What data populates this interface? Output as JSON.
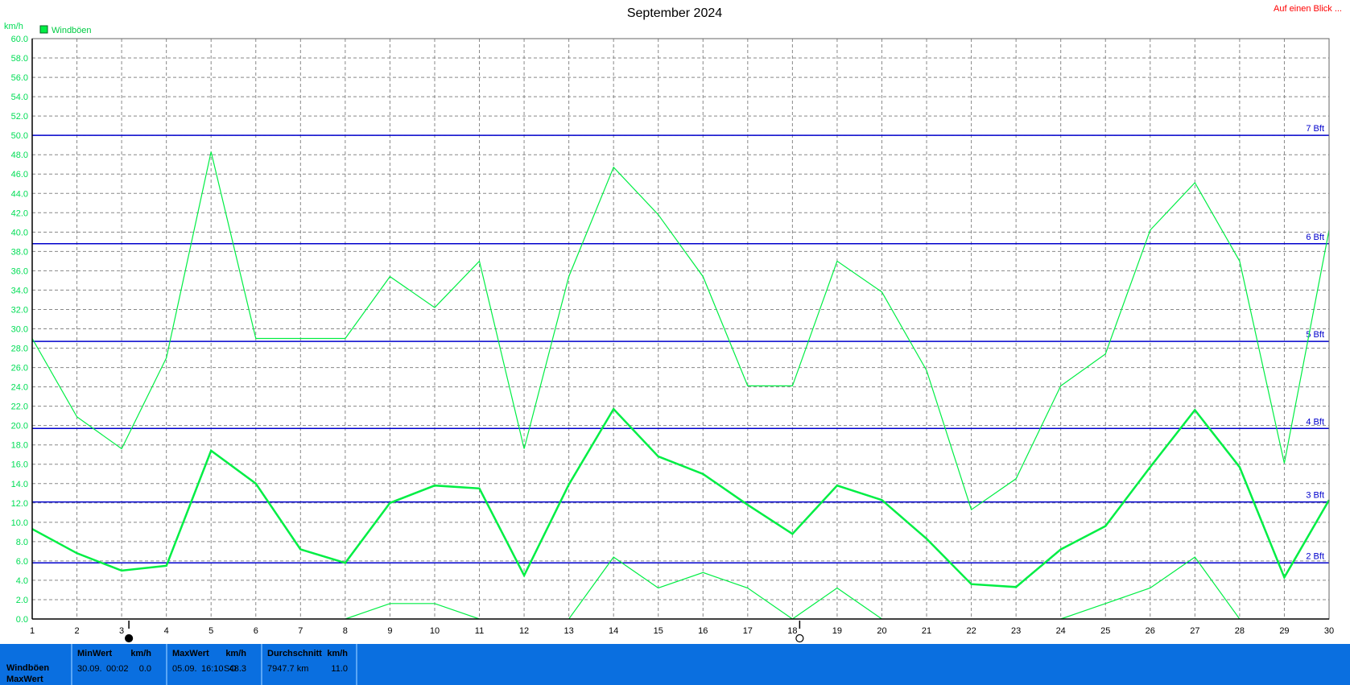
{
  "page": {
    "title": "September 2024",
    "top_link": "Auf einen Blick ...",
    "unit_label": "km/h",
    "colors": {
      "series": "#00ee44",
      "bft_line": "#0000cc",
      "stats_bg": "#0a6fe0",
      "link": "#ff0000"
    }
  },
  "chart_data": {
    "type": "line",
    "title": "September 2024",
    "ylabel": "km/h",
    "xlabel": "",
    "x": [
      1,
      2,
      3,
      4,
      5,
      6,
      7,
      8,
      9,
      10,
      11,
      12,
      13,
      14,
      15,
      16,
      17,
      18,
      19,
      20,
      21,
      22,
      23,
      24,
      25,
      26,
      27,
      28,
      29,
      30
    ],
    "ylim": [
      0,
      60
    ],
    "yticks": [
      "0.0",
      "2.0",
      "4.0",
      "6.0",
      "8.0",
      "10.0",
      "12.0",
      "14.0",
      "16.0",
      "18.0",
      "20.0",
      "22.0",
      "24.0",
      "26.0",
      "28.0",
      "30.0",
      "32.0",
      "34.0",
      "36.0",
      "38.0",
      "40.0",
      "42.0",
      "44.0",
      "46.0",
      "48.0",
      "50.0",
      "52.0",
      "54.0",
      "56.0",
      "58.0",
      "60.0"
    ],
    "grid": true,
    "legend": {
      "position": "top-left",
      "entries": [
        "Windböen"
      ]
    },
    "series": [
      {
        "name": "Windböen",
        "role": "average",
        "values": [
          9.3,
          6.8,
          5.0,
          5.5,
          17.4,
          14.0,
          7.2,
          5.8,
          12.0,
          13.8,
          13.5,
          4.5,
          13.9,
          21.7,
          16.8,
          15.0,
          11.8,
          8.8,
          13.8,
          12.3,
          8.3,
          3.6,
          3.3,
          7.2,
          9.6,
          15.7,
          21.6,
          15.7,
          4.3,
          12.3
        ]
      },
      {
        "role": "max",
        "values": [
          29.0,
          20.9,
          17.6,
          27.0,
          48.3,
          29.0,
          29.0,
          29.0,
          35.4,
          32.2,
          37.0,
          17.6,
          35.4,
          46.7,
          41.8,
          35.4,
          24.1,
          24.1,
          37.0,
          33.8,
          25.7,
          11.3,
          14.5,
          24.1,
          27.4,
          40.2,
          45.1,
          37.0,
          16.1,
          40.2
        ]
      },
      {
        "role": "min",
        "values": [
          null,
          null,
          null,
          null,
          null,
          null,
          null,
          0.0,
          1.6,
          1.6,
          0.0,
          null,
          0.0,
          6.4,
          3.2,
          4.8,
          3.2,
          0.0,
          3.2,
          0.0,
          null,
          null,
          null,
          0.0,
          1.6,
          3.2,
          6.4,
          0.0,
          null,
          null
        ]
      }
    ],
    "reference_lines": [
      {
        "label": "2 Bft",
        "value": 5.8
      },
      {
        "label": "3 Bft",
        "value": 12.1
      },
      {
        "label": "4 Bft",
        "value": 19.7
      },
      {
        "label": "5 Bft",
        "value": 28.7
      },
      {
        "label": "6 Bft",
        "value": 38.8
      },
      {
        "label": "7 Bft",
        "value": 50.0
      }
    ],
    "moon_phases": [
      {
        "day": 3,
        "phase": "new-moon"
      },
      {
        "day": 18,
        "phase": "full-moon"
      }
    ]
  },
  "stats": {
    "row_labels": [
      "Windböen",
      "MaxWert"
    ],
    "min": {
      "header": "MinWert",
      "unit": "km/h",
      "date": "30.09.",
      "time": "00:02",
      "value": "0.0"
    },
    "max": {
      "header": "MaxWert",
      "unit": "km/h",
      "date": "05.09.",
      "time": "16:10",
      "dir": "SO",
      "value": "48.3"
    },
    "avg": {
      "header": "Durchschnitt",
      "unit": "km/h",
      "distance": "7947.7 km",
      "value": "11.0"
    }
  }
}
